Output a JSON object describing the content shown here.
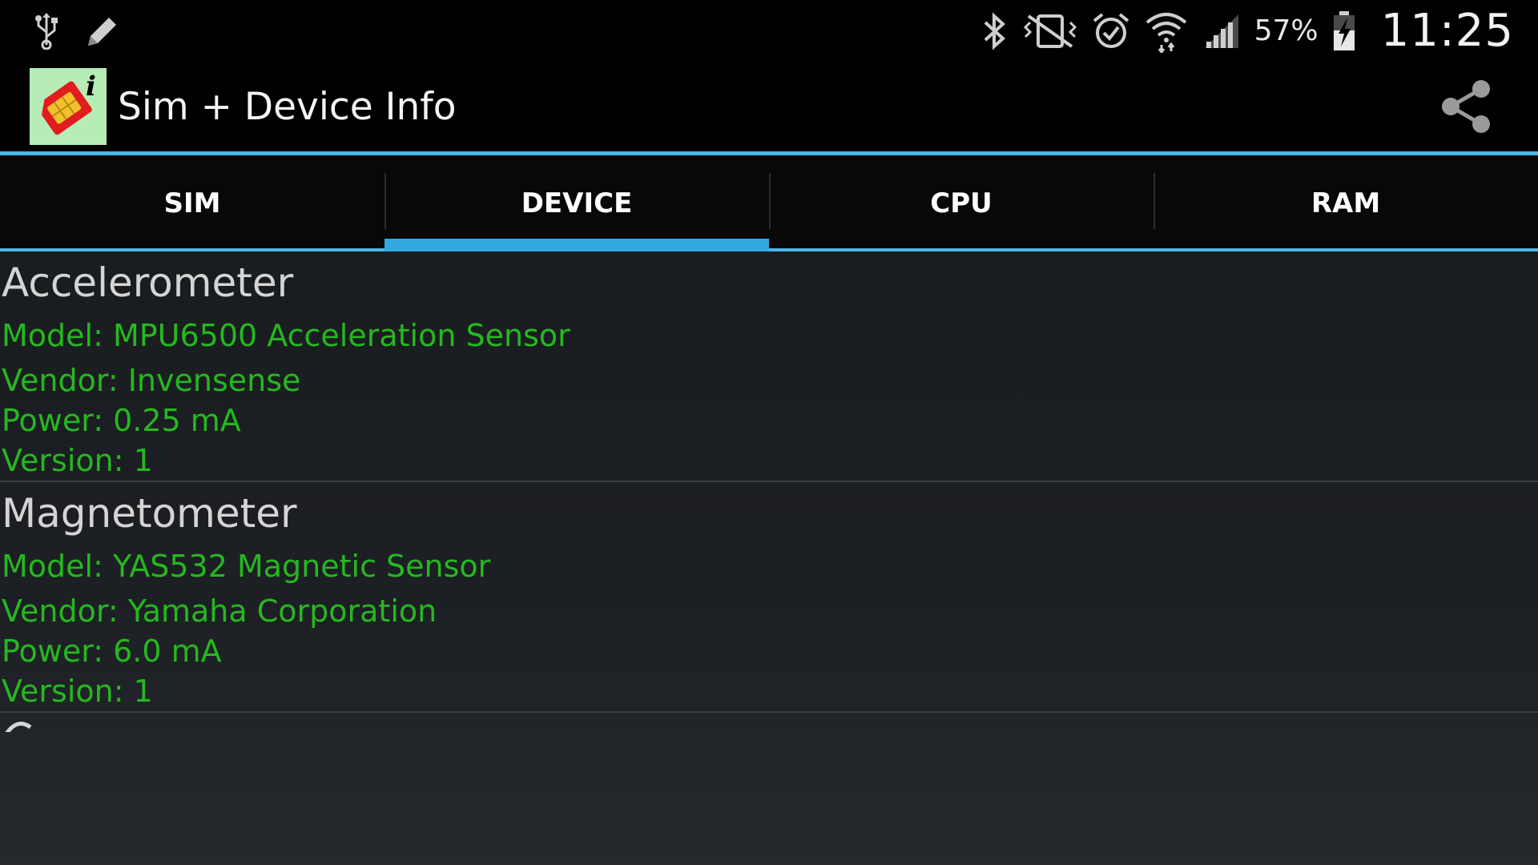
{
  "status_bar": {
    "left_icons": [
      "usb-icon",
      "edit-icon"
    ],
    "right_icons": [
      "bluetooth-icon",
      "vibrate-mute-icon",
      "alarm-icon",
      "wifi-icon",
      "signal-icon"
    ],
    "battery_percent": "57%",
    "battery_level": 0.57,
    "time": "11:25"
  },
  "action_bar": {
    "title": "Sim + Device Info",
    "share_icon": "share-icon"
  },
  "tabs": [
    {
      "label": "SIM",
      "active": false
    },
    {
      "label": "DEVICE",
      "active": true
    },
    {
      "label": "CPU",
      "active": false
    },
    {
      "label": "RAM",
      "active": false
    }
  ],
  "sensors": [
    {
      "title": "Accelerometer",
      "model": "Model: MPU6500 Acceleration Sensor",
      "vendor": "Vendor: Invensense",
      "power": "Power: 0.25 mA",
      "version": "Version: 1"
    },
    {
      "title": "Magnetometer",
      "model": "Model: YAS532 Magnetic Sensor",
      "vendor": "Vendor: Yamaha Corporation",
      "power": "Power: 6.0 mA",
      "version": "Version: 1"
    }
  ],
  "colors": {
    "accent": "#4bb6e8",
    "value_green": "#25b81f",
    "heading_gray": "#d4d4d4"
  }
}
